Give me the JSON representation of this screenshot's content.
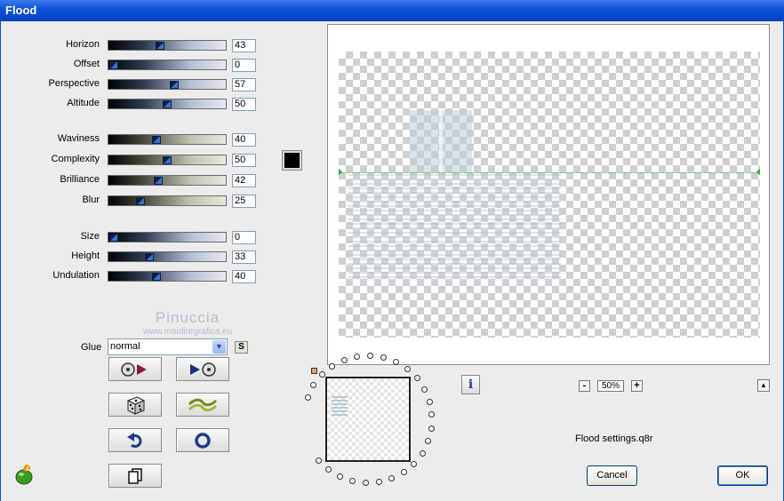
{
  "window": {
    "title": "Flood"
  },
  "sliders_group1": [
    {
      "label": "Horizon",
      "value": "43",
      "pct": 43,
      "style": "blue"
    },
    {
      "label": "Offset",
      "value": "0",
      "pct": 0,
      "style": "blue"
    },
    {
      "label": "Perspective",
      "value": "57",
      "pct": 57,
      "style": "blue"
    },
    {
      "label": "Altitude",
      "value": "50",
      "pct": 50,
      "style": "blue"
    }
  ],
  "sliders_group2": [
    {
      "label": "Waviness",
      "value": "40",
      "pct": 40,
      "style": "khaki"
    },
    {
      "label": "Complexity",
      "value": "50",
      "pct": 50,
      "style": "khaki"
    },
    {
      "label": "Brilliance",
      "value": "42",
      "pct": 42,
      "style": "khaki"
    },
    {
      "label": "Blur",
      "value": "25",
      "pct": 25,
      "style": "khaki"
    }
  ],
  "sliders_group3": [
    {
      "label": "Size",
      "value": "0",
      "pct": 0,
      "style": "blue"
    },
    {
      "label": "Height",
      "value": "33",
      "pct": 33,
      "style": "blue"
    },
    {
      "label": "Undulation",
      "value": "40",
      "pct": 40,
      "style": "blue"
    }
  ],
  "color_swatch": {
    "color": "#000000"
  },
  "watermark": {
    "line1": "Pinuccia",
    "line2": "www.maidiregrafica.eu"
  },
  "glue": {
    "label": "Glue",
    "value": "normal",
    "sync_label": "S"
  },
  "tool_buttons": [
    "load-preset-icon",
    "save-preset-icon",
    "random-dice-icon",
    "wave-icon",
    "undo-icon",
    "reset-icon",
    "copy-icon"
  ],
  "zoom": {
    "value": "50%",
    "minus": "-",
    "plus": "+"
  },
  "info_button": {
    "label": "i"
  },
  "settings_file": "Flood settings.q8r",
  "buttons": {
    "cancel": "Cancel",
    "ok": "OK"
  },
  "colors": {
    "titlebar": "#0a50d8",
    "horizon_marker": "#2fae3b"
  }
}
